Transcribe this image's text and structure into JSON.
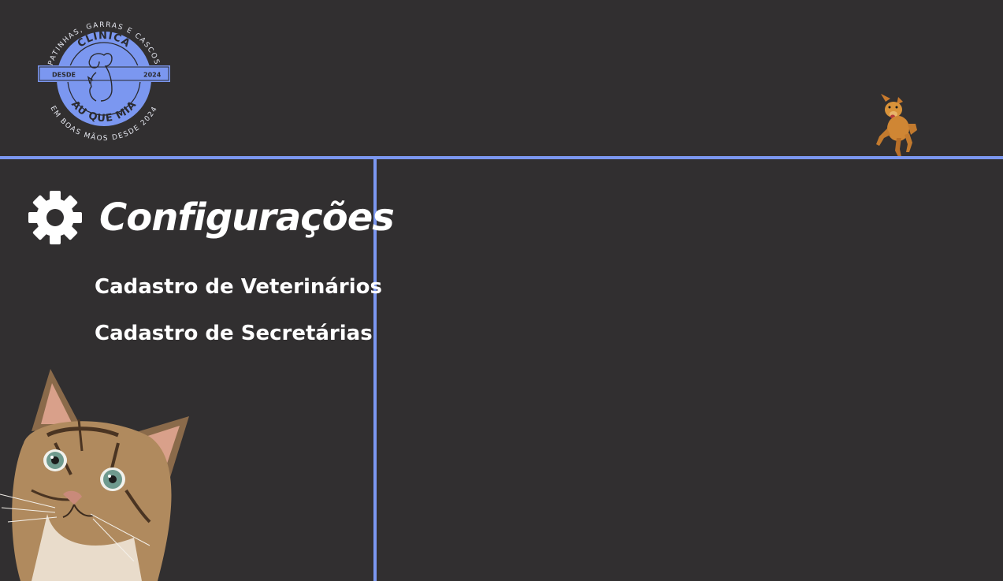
{
  "logo": {
    "top_arc": "PATINHAS, GARRAS E CASCOS",
    "name_top": "CLÍNICA",
    "name_bottom": "AU QUE MIA",
    "left_tag": "DESDE",
    "right_tag": "2024",
    "bottom_arc": "EM BOAS MÃOS DESDE 2024"
  },
  "sidebar": {
    "title": "Configurações",
    "title_icon": "gear-icon",
    "items": [
      {
        "label": "Cadastro de Veterinários"
      },
      {
        "label": "Cadastro de Secretárias"
      }
    ]
  },
  "theme": {
    "background": "#312f30",
    "accent": "#7b97f0",
    "text": "#ffffff"
  }
}
